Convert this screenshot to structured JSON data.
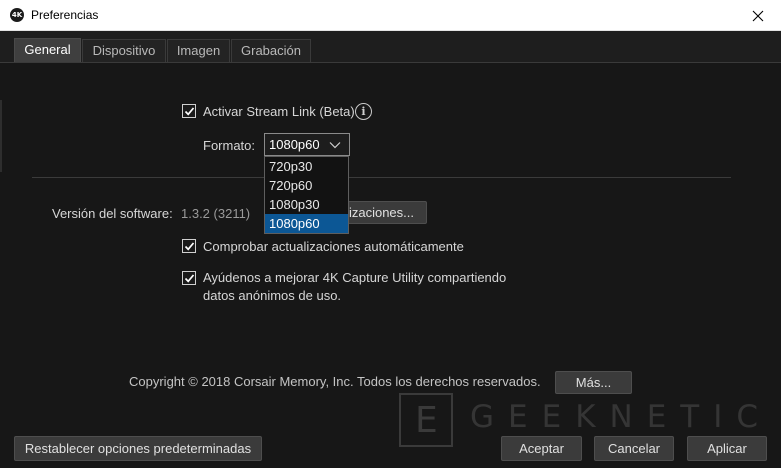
{
  "window": {
    "app_icon_text": "4K",
    "title": "Preferencias"
  },
  "tabs": [
    {
      "label": "General",
      "active": true
    },
    {
      "label": "Dispositivo",
      "active": false
    },
    {
      "label": "Imagen",
      "active": false
    },
    {
      "label": "Grabación",
      "active": false
    }
  ],
  "stream_link": {
    "checkbox_label": "Activar Stream Link (Beta)",
    "checked": true,
    "info_icon": "i",
    "format_label": "Formato:",
    "format_value": "1080p60",
    "options": [
      "720p30",
      "720p60",
      "1080p30",
      "1080p60"
    ],
    "selected_option": "1080p60"
  },
  "software": {
    "version_label": "Versión del software:",
    "version_value": "1.3.2 (3211)",
    "check_updates_button_visible": "lizaciones...",
    "auto_update_label": "Comprobar actualizaciones automáticamente",
    "auto_update_checked": true,
    "improve_label_line1": "Ayúdenos a mejorar 4K Capture Utility compartiendo",
    "improve_label_line2": "datos anónimos de uso.",
    "improve_checked": true
  },
  "footer": {
    "copyright": "Copyright © 2018 Corsair Memory, Inc. Todos los derechos reservados.",
    "more_button": "Más...",
    "reset_button": "Restablecer opciones predeterminadas",
    "accept_button": "Aceptar",
    "cancel_button": "Cancelar",
    "apply_button": "Aplicar"
  },
  "watermark": {
    "letter": "E",
    "text": "GEEKNETIC"
  },
  "colors": {
    "background": "#171717",
    "selection": "#0c5795",
    "button": "#3b3b3b"
  }
}
